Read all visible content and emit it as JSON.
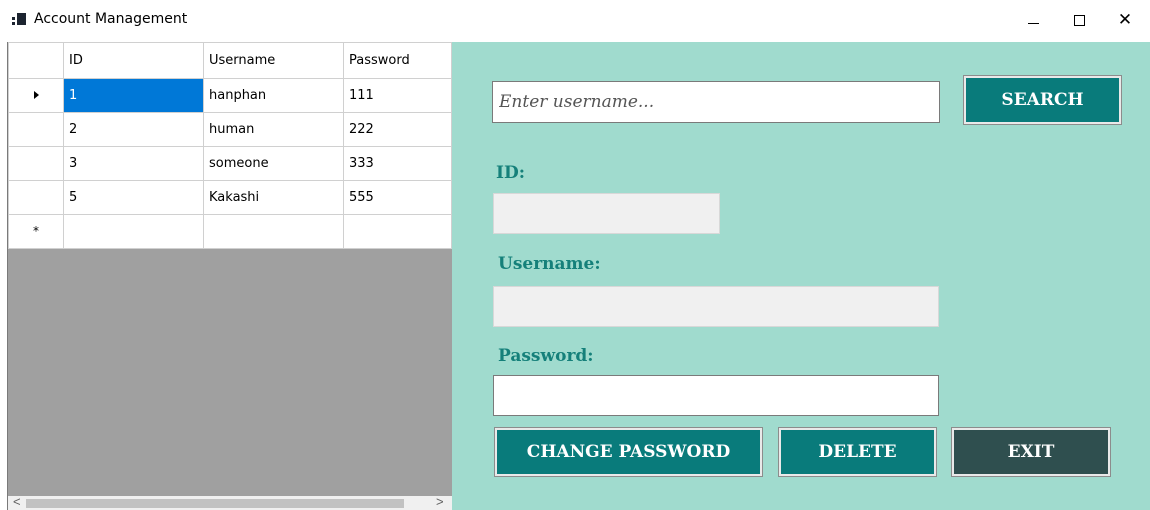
{
  "window": {
    "title": "Account Management",
    "controls": {
      "minimize": "minimize",
      "maximize": "maximize",
      "close": "✕"
    }
  },
  "grid": {
    "columns": [
      "ID",
      "Username",
      "Password"
    ],
    "rows": [
      {
        "id": "1",
        "username": "hanphan",
        "password": "111"
      },
      {
        "id": "2",
        "username": "human",
        "password": "222"
      },
      {
        "id": "3",
        "username": "someone",
        "password": "333"
      },
      {
        "id": "5",
        "username": "Kakashi",
        "password": "555"
      }
    ],
    "new_row_marker": "*",
    "scroll_left": "<",
    "scroll_right": ">"
  },
  "search": {
    "placeholder": "Enter username...",
    "value": "",
    "button_label": "SEARCH"
  },
  "form": {
    "id_label": "ID:",
    "id_value": "",
    "username_label": "Username:",
    "username_value": "",
    "password_label": "Password:",
    "password_value": ""
  },
  "actions": {
    "change_password_label": "CHANGE PASSWORD",
    "delete_label": "DELETE",
    "exit_label": "EXIT"
  },
  "colors": {
    "panel_bg": "#a0dbce",
    "accent_teal": "#097b7b",
    "exit_dark": "#2f4f4f",
    "label_text": "#15807a",
    "selection": "#0078d7",
    "grid_empty_bg": "#a0a0a0"
  }
}
